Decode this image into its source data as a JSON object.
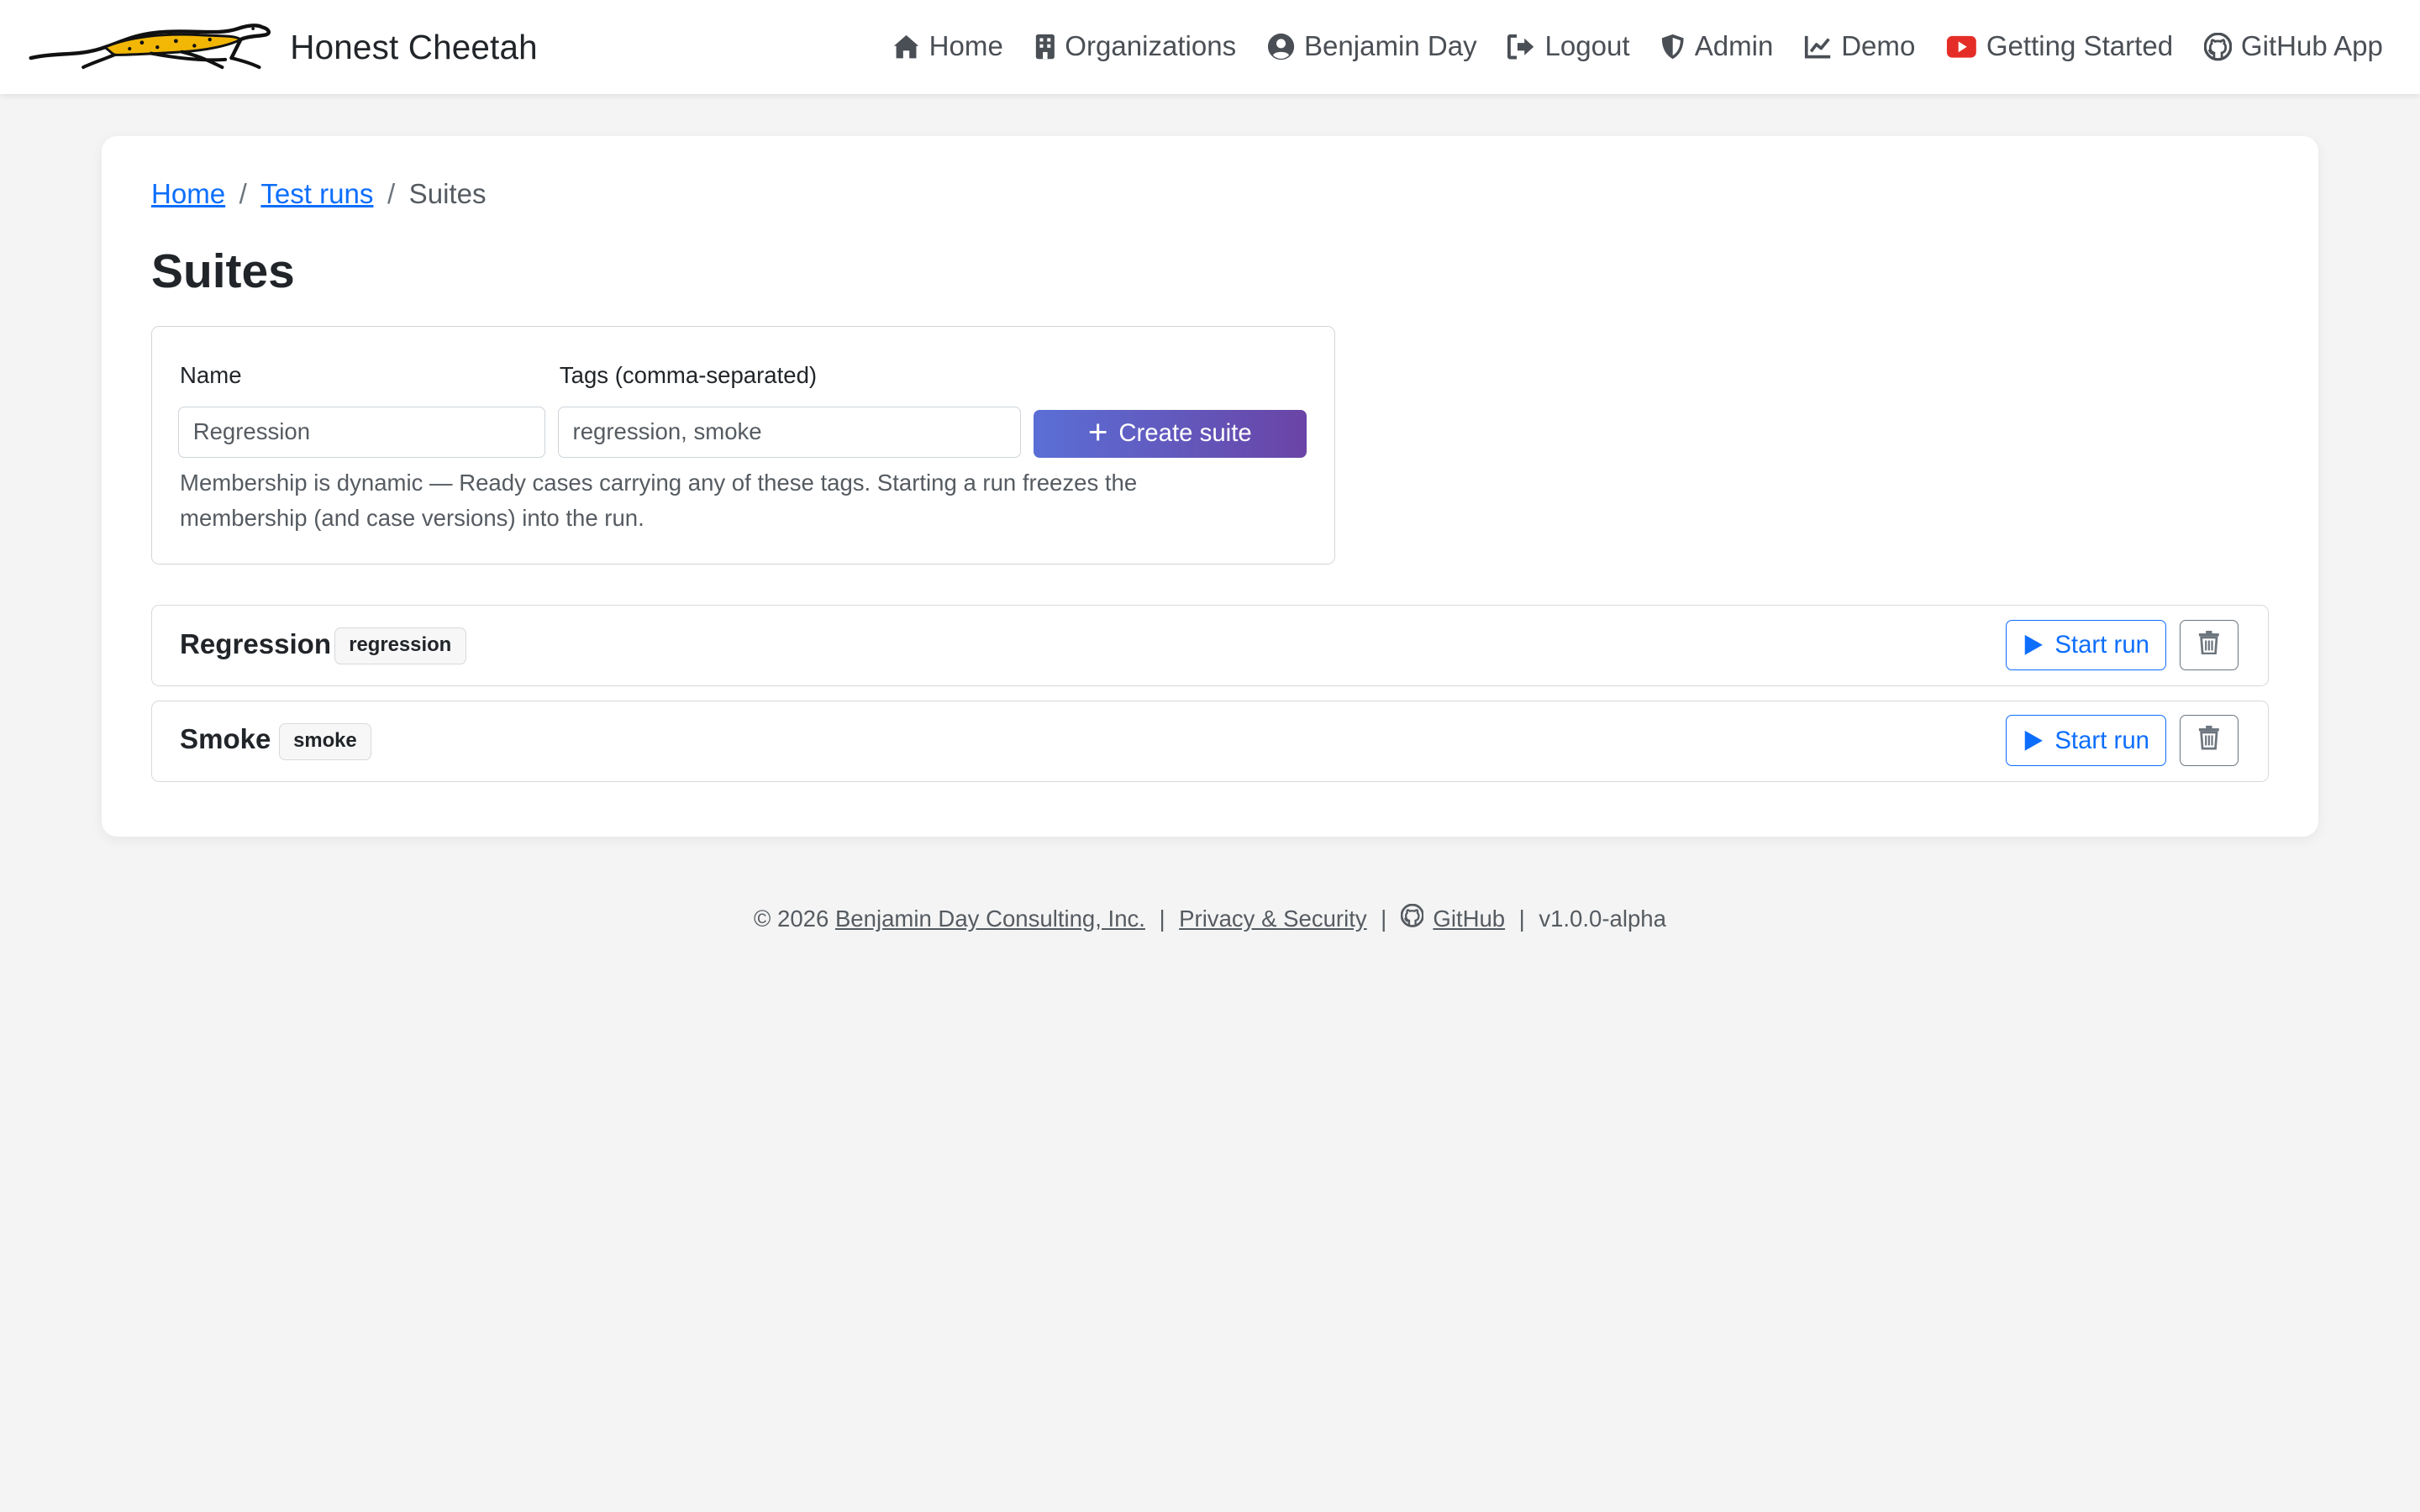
{
  "app": {
    "name": "Honest Cheetah",
    "logo_icon": "cheetah-logo"
  },
  "nav": {
    "items": [
      {
        "label": "Home",
        "icon": "home-icon"
      },
      {
        "label": "Organizations",
        "icon": "building-icon"
      },
      {
        "label": "Benjamin Day",
        "icon": "user-circle-icon"
      },
      {
        "label": "Logout",
        "icon": "logout-icon"
      },
      {
        "label": "Admin",
        "icon": "shield-icon"
      },
      {
        "label": "Demo",
        "icon": "chart-line-icon"
      },
      {
        "label": "Getting Started",
        "icon": "youtube-icon",
        "icon_color": "#e52d27"
      },
      {
        "label": "GitHub App",
        "icon": "github-icon"
      }
    ]
  },
  "breadcrumb": {
    "items": [
      {
        "label": "Home",
        "link": true
      },
      {
        "label": "Test runs",
        "link": true
      },
      {
        "label": "Suites",
        "link": false
      }
    ],
    "separator": "/"
  },
  "page": {
    "title": "Suites"
  },
  "create_form": {
    "name_label": "Name",
    "name_value": "Regression",
    "tags_label": "Tags (comma-separated)",
    "tags_value": "regression, smoke",
    "submit_label": "Create suite",
    "help_text": "Membership is dynamic — Ready cases carrying any of these tags. Starting a run freezes the membership (and case versions) into the run."
  },
  "suites": [
    {
      "name": "Regression",
      "tag": "regression",
      "start_label": "Start run"
    },
    {
      "name": "Smoke",
      "tag": "smoke",
      "start_label": "Start run"
    }
  ],
  "footer": {
    "copyright": "© 2026",
    "company": "Benjamin Day Consulting, Inc.",
    "privacy": "Privacy & Security",
    "github": "GitHub",
    "version": "v1.0.0-alpha",
    "separator": "|"
  },
  "colors": {
    "primary": "#0d6efd",
    "create_gradient_start": "#5a6fd6",
    "create_gradient_end": "#6a44a6",
    "background": "#f4f4f4",
    "cheetah_yellow": "#f2b705"
  }
}
